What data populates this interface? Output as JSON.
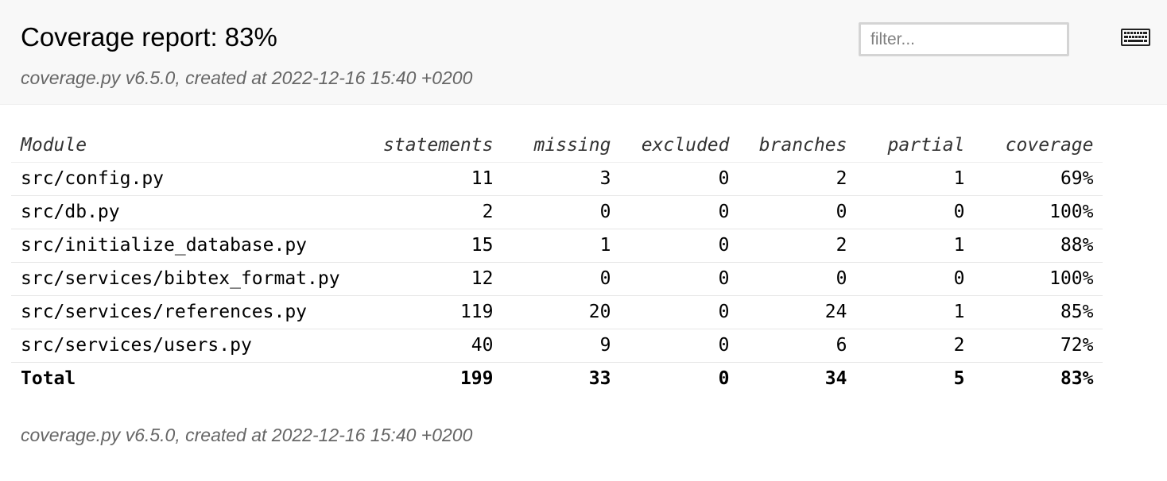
{
  "header": {
    "title": "Coverage report: 83%",
    "meta": "coverage.py v6.5.0, created at 2022-12-16 15:40 +0200",
    "filter_placeholder": "filter..."
  },
  "icons": {
    "keyboard": "keyboard-icon"
  },
  "table": {
    "columns": [
      "Module",
      "statements",
      "missing",
      "excluded",
      "branches",
      "partial",
      "coverage"
    ],
    "rows": [
      {
        "module": "src/config.py",
        "statements": "11",
        "missing": "3",
        "excluded": "0",
        "branches": "2",
        "partial": "1",
        "coverage": "69%"
      },
      {
        "module": "src/db.py",
        "statements": "2",
        "missing": "0",
        "excluded": "0",
        "branches": "0",
        "partial": "0",
        "coverage": "100%"
      },
      {
        "module": "src/initialize_database.py",
        "statements": "15",
        "missing": "1",
        "excluded": "0",
        "branches": "2",
        "partial": "1",
        "coverage": "88%"
      },
      {
        "module": "src/services/bibtex_format.py",
        "statements": "12",
        "missing": "0",
        "excluded": "0",
        "branches": "0",
        "partial": "0",
        "coverage": "100%"
      },
      {
        "module": "src/services/references.py",
        "statements": "119",
        "missing": "20",
        "excluded": "0",
        "branches": "24",
        "partial": "1",
        "coverage": "85%"
      },
      {
        "module": "src/services/users.py",
        "statements": "40",
        "missing": "9",
        "excluded": "0",
        "branches": "6",
        "partial": "2",
        "coverage": "72%"
      }
    ],
    "total": {
      "module": "Total",
      "statements": "199",
      "missing": "33",
      "excluded": "0",
      "branches": "34",
      "partial": "5",
      "coverage": "83%"
    }
  },
  "footer": {
    "meta": "coverage.py v6.5.0, created at 2022-12-16 15:40 +0200"
  }
}
